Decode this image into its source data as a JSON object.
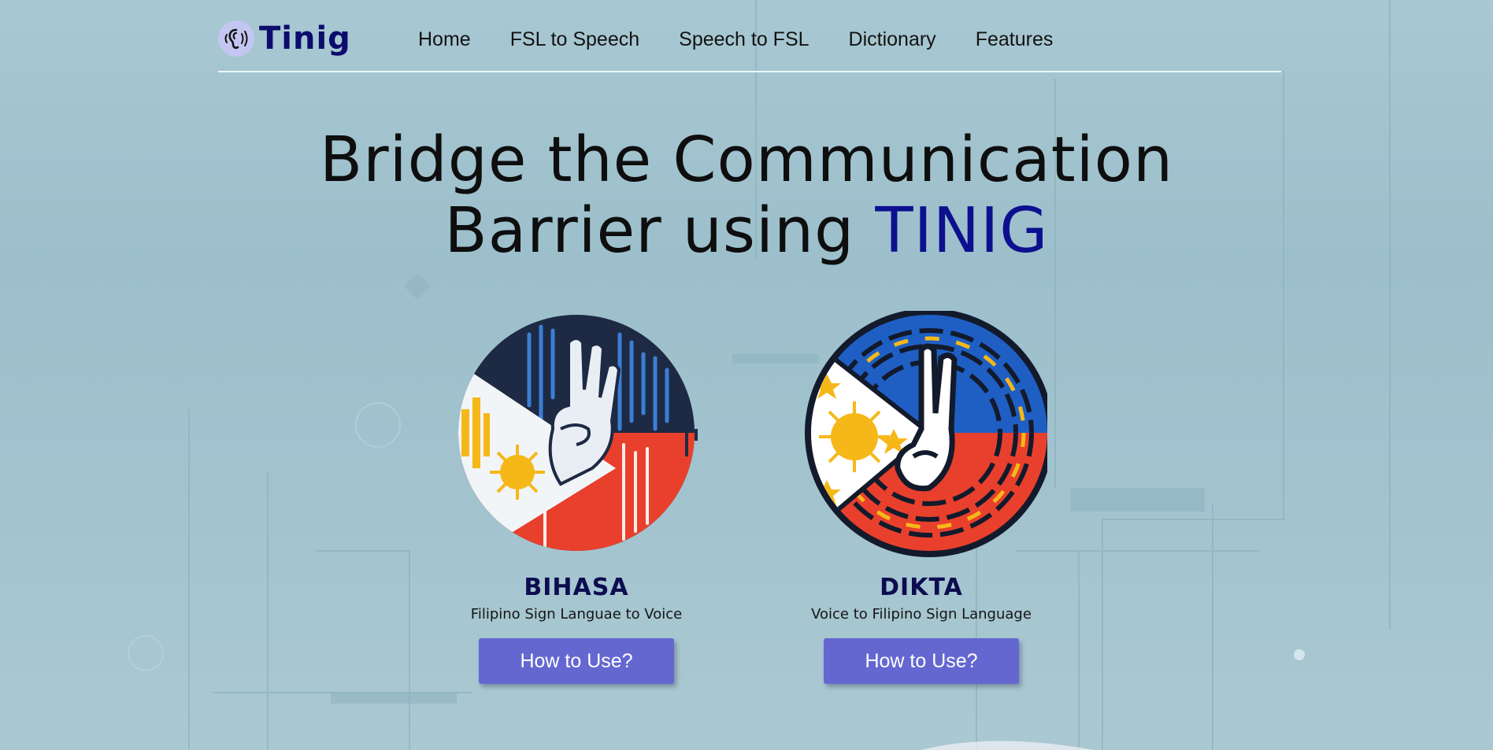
{
  "app": {
    "logo_text": "Tinig"
  },
  "nav": {
    "items": [
      {
        "label": "Home"
      },
      {
        "label": "FSL to Speech"
      },
      {
        "label": "Speech to FSL"
      },
      {
        "label": "Dictionary"
      },
      {
        "label": "Features"
      }
    ]
  },
  "hero": {
    "line1": "Bridge the Communication",
    "line2_prefix": "Barrier using ",
    "line2_accent": "TINIG"
  },
  "cards": [
    {
      "title": "BIHASA",
      "subtitle": "Filipino Sign Languae to Voice",
      "button_label": "How to Use?",
      "icon": "fsl-to-voice-logo"
    },
    {
      "title": "DIKTA",
      "subtitle": "Voice to Filipino Sign Language",
      "button_label": "How to Use?",
      "icon": "voice-to-fsl-logo"
    }
  ],
  "colors": {
    "accent": "#0c108f",
    "button": "#6567d1",
    "logo_text": "#0c0c6e",
    "card_title": "#0c0c50",
    "flag_blue": "#1f5fc4",
    "flag_red": "#e8402c",
    "flag_yellow": "#f6b819"
  }
}
